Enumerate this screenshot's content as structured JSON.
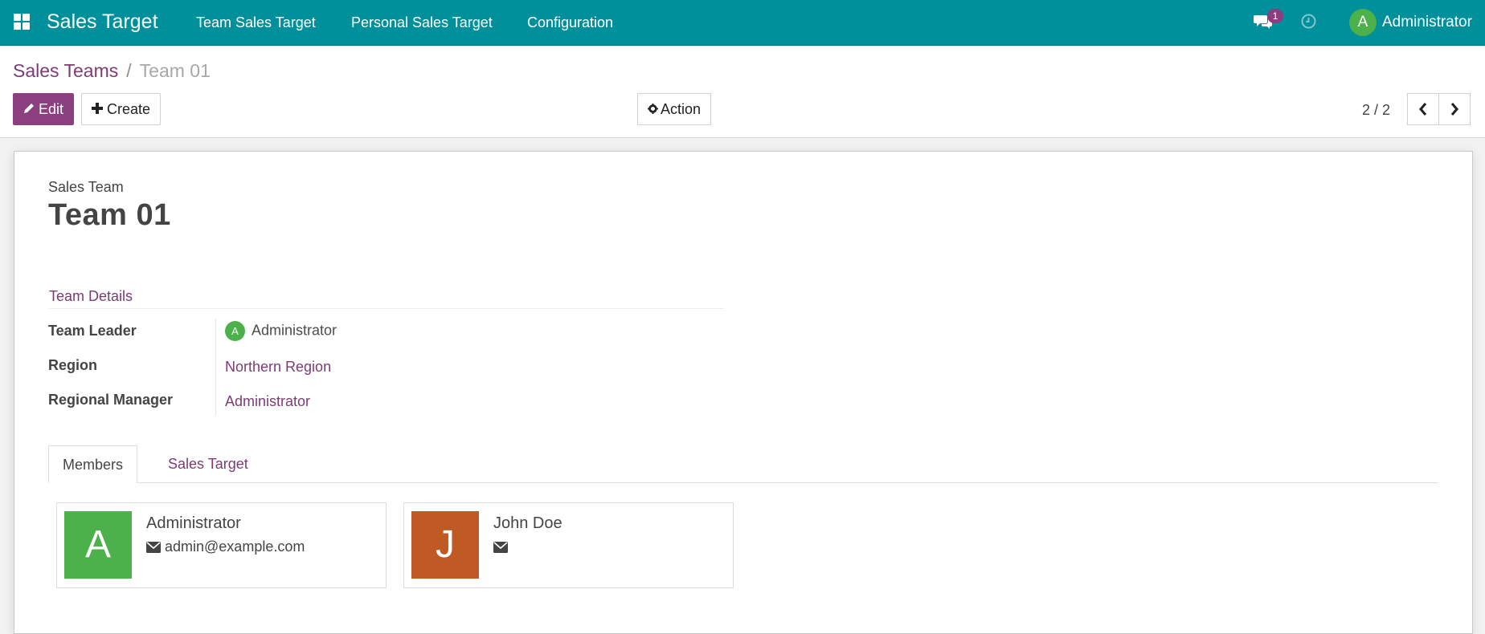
{
  "navbar": {
    "app_title": "Sales Target",
    "menu": [
      "Team Sales Target",
      "Personal Sales Target",
      "Configuration"
    ],
    "chat_count": "1",
    "user_initial": "A",
    "user_name": "Administrator",
    "bg_color": "#00909c"
  },
  "breadcrumb": {
    "parent": "Sales Teams",
    "separator": "/",
    "current": "Team 01"
  },
  "toolbar": {
    "edit_label": "Edit",
    "create_label": "Create",
    "action_label": "Action",
    "pager": "2 / 2"
  },
  "form": {
    "label": "Sales Team",
    "name": "Team 01",
    "group_title": "Team Details",
    "fields": {
      "team_leader_label": "Team Leader",
      "team_leader_initial": "A",
      "team_leader_value": "Administrator",
      "region_label": "Region",
      "region_value": "Northern Region",
      "regional_manager_label": "Regional Manager",
      "regional_manager_value": "Administrator"
    },
    "tabs": [
      "Members",
      "Sales Target"
    ],
    "active_tab": "Members",
    "members": [
      {
        "initial": "A",
        "name": "Administrator",
        "email": "admin@example.com",
        "color": "#4cb14a"
      },
      {
        "initial": "J",
        "name": "John Doe",
        "email": "",
        "color": "#c05a25"
      }
    ]
  }
}
